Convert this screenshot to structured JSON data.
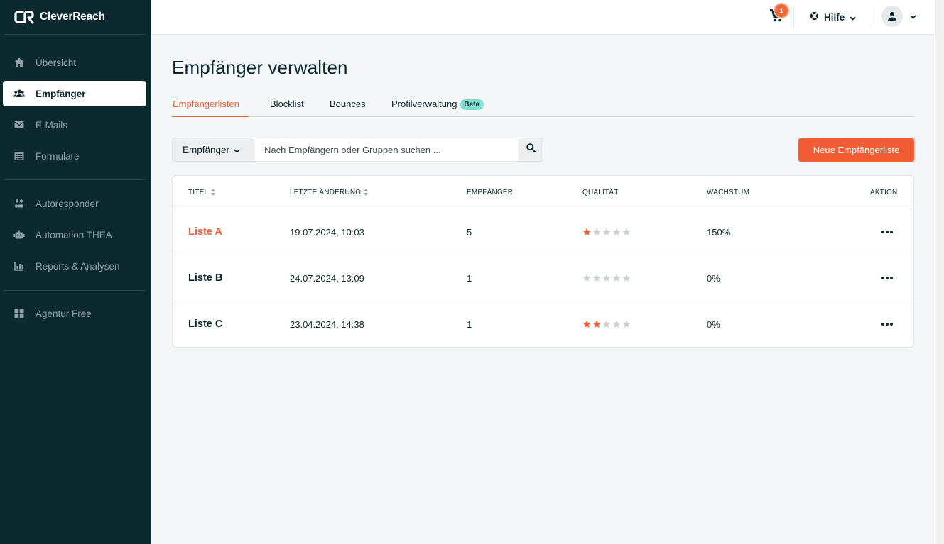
{
  "app": {
    "brand": "CleverReach"
  },
  "sidebar": {
    "items": [
      {
        "label": "Übersicht",
        "icon": "home-icon",
        "active": false
      },
      {
        "label": "Empfänger",
        "icon": "users-icon",
        "active": true
      },
      {
        "label": "E-Mails",
        "icon": "envelope-icon",
        "active": false
      },
      {
        "label": "Formulare",
        "icon": "form-icon",
        "active": false
      },
      {
        "label": "Autoresponder",
        "icon": "autoresponder-icon",
        "active": false
      },
      {
        "label": "Automation THEA",
        "icon": "robot-icon",
        "active": false
      },
      {
        "label": "Reports & Analysen",
        "icon": "chart-icon",
        "active": false
      },
      {
        "label": "Agentur Free",
        "icon": "grid-icon",
        "active": false
      }
    ]
  },
  "topbar": {
    "cart_count": "1",
    "help_label": "Hilfe"
  },
  "page": {
    "title": "Empfänger verwalten"
  },
  "tabs": [
    {
      "label": "Empfängerlisten",
      "active": true
    },
    {
      "label": "Blocklist",
      "active": false
    },
    {
      "label": "Bounces",
      "active": false
    },
    {
      "label": "Profilverwaltung",
      "active": false,
      "badge": "Beta"
    }
  ],
  "toolbar": {
    "filter_value": "Empfänger",
    "search_placeholder": "Nach Empfängern oder Gruppen suchen ...",
    "new_button": "Neue Empfängerliste"
  },
  "table": {
    "columns": {
      "title": "TITEL",
      "modified": "LETZTE ÄNDERUNG",
      "recipients": "EMPFÄNGER",
      "quality": "QUALITÄT",
      "growth": "WACHSTUM",
      "action": "AKTION"
    },
    "rows": [
      {
        "title": "Liste A",
        "modified": "19.07.2024, 10:03",
        "recipients": "5",
        "quality": 1,
        "growth": "150%"
      },
      {
        "title": "Liste B",
        "modified": "24.07.2024, 13:09",
        "recipients": "1",
        "quality": 0,
        "growth": "0%"
      },
      {
        "title": "Liste C",
        "modified": "23.04.2024, 14:38",
        "recipients": "1",
        "quality": 2,
        "growth": "0%"
      }
    ]
  },
  "colors": {
    "sidebar_bg": "#0c2930",
    "accent": "#f25c34",
    "star_filled": "#f25c34",
    "star_empty": "#c9d0d3"
  }
}
